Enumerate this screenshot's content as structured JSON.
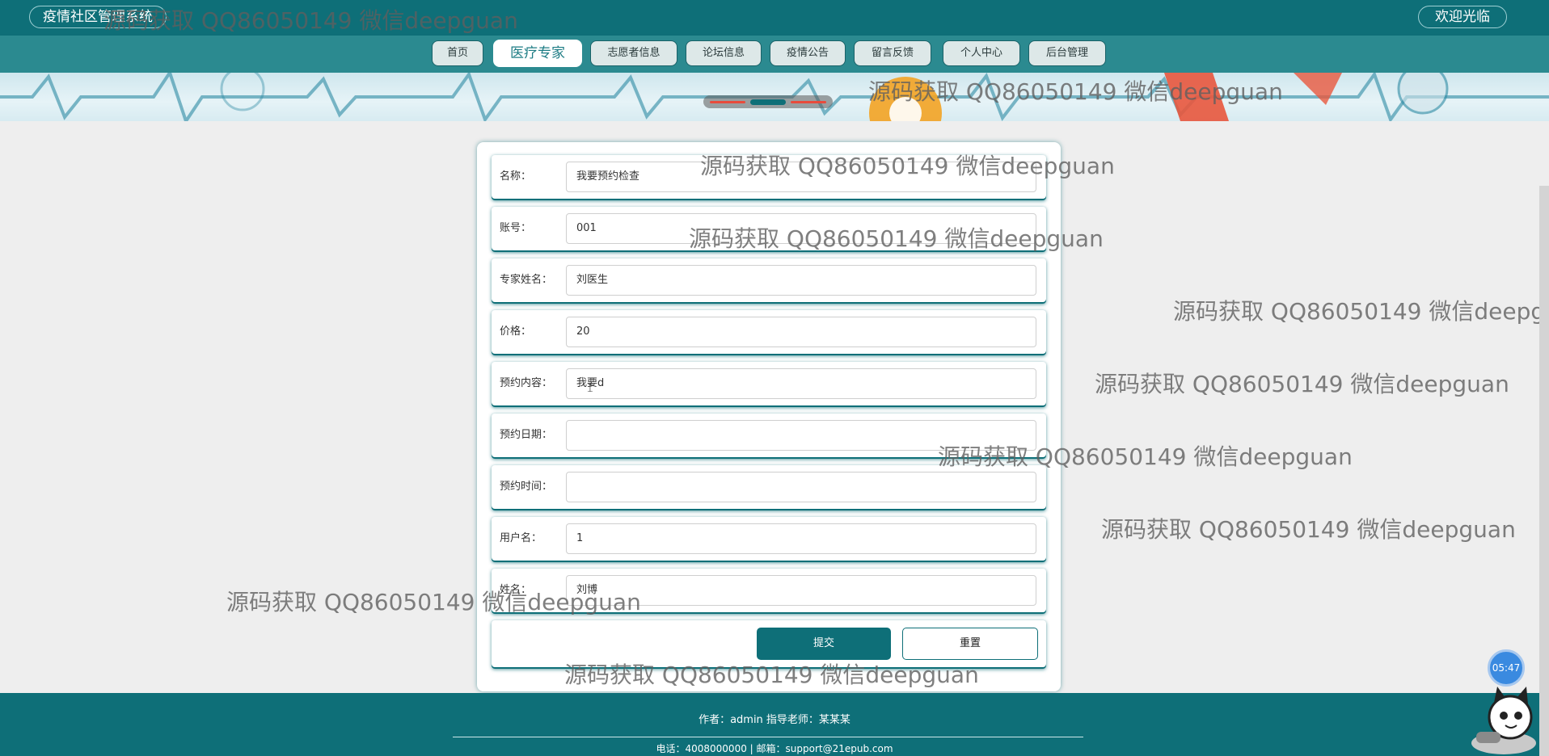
{
  "header": {
    "app_title": "疫情社区管理系统",
    "welcome": "欢迎光临"
  },
  "nav": {
    "items": [
      {
        "label": "首页"
      },
      {
        "label": "医疗专家"
      },
      {
        "label": "志愿者信息"
      },
      {
        "label": "论坛信息"
      },
      {
        "label": "疫情公告"
      },
      {
        "label": "留言反馈"
      },
      {
        "label": "个人中心"
      },
      {
        "label": "后台管理"
      }
    ],
    "active": "医疗专家"
  },
  "form": {
    "fields": [
      {
        "label": "名称：",
        "value": "我要预约检查"
      },
      {
        "label": "账号：",
        "value": "001"
      },
      {
        "label": "专家姓名：",
        "value": "刘医生"
      },
      {
        "label": "价格：",
        "value": "20"
      },
      {
        "label": "预约内容：",
        "value": "我要d"
      },
      {
        "label": "预约日期：",
        "value": ""
      },
      {
        "label": "预约时间：",
        "value": ""
      },
      {
        "label": "用户名：",
        "value": "1"
      },
      {
        "label": "姓名：",
        "value": "刘博"
      }
    ],
    "submit_label": "提交",
    "reset_label": "重置"
  },
  "footer": {
    "author": "作者：admin 指导老师：某某某",
    "contact": "电话：4008000000 | 邮箱：support@21epub.com"
  },
  "watermark": "源码获取 QQ86050149 微信deepguan",
  "clock": "05:47",
  "colors": {
    "primary": "#0e6f78",
    "nav_bg": "#2b8a90",
    "accent_red": "#e84b3c"
  }
}
